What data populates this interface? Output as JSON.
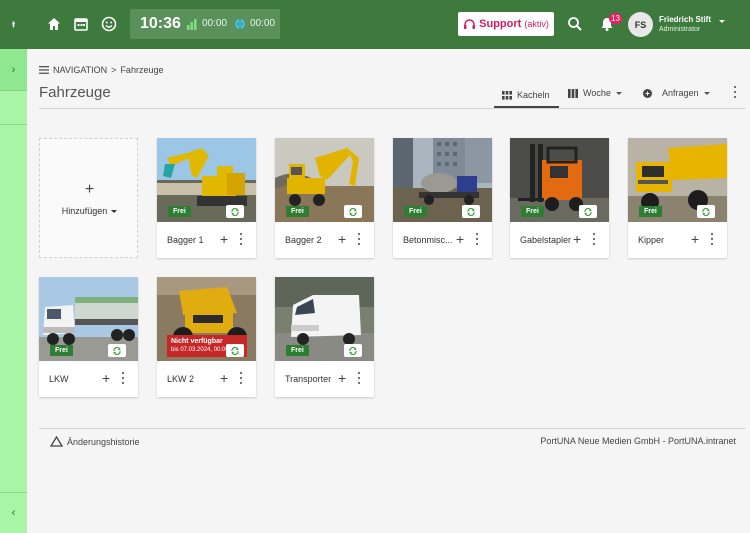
{
  "header": {
    "clock": "10:36",
    "timer1": "00:00",
    "timer2": "00:00",
    "support_label": "Support",
    "support_status": "(aktiv)",
    "notification_count": "13",
    "user_initials": "FS",
    "user_name": "Friedrich Stift",
    "user_role": "Administrator"
  },
  "breadcrumb": {
    "nav": "NAVIGATION",
    "separator": ">",
    "current": "Fahrzeuge"
  },
  "page": {
    "title": "Fahrzeuge"
  },
  "view_controls": {
    "tiles_label": "Kacheln",
    "week_label": "Woche",
    "requests_label": "Anfragen"
  },
  "add_tile": {
    "plus": "+",
    "label": "Hinzufügen"
  },
  "vehicles": [
    {
      "name": "Bagger 1",
      "status": "Frei"
    },
    {
      "name": "Bagger 2",
      "status": "Frei"
    },
    {
      "name": "Betonmisc...",
      "status": "Frei"
    },
    {
      "name": "Gabelstapler",
      "status": "Frei"
    },
    {
      "name": "Kipper",
      "status": "Frei"
    },
    {
      "name": "LKW",
      "status": "Frei"
    },
    {
      "name": "LKW 2",
      "status": "Nicht verfügbar",
      "status_detail": "bis 07.03.2024, 00:00"
    },
    {
      "name": "Transporter",
      "status": "Frei"
    }
  ],
  "tile_actions": {
    "plus": "+"
  },
  "footer": {
    "history": "Änderungshistorie",
    "copyright": "PortUNA Neue Medien GmbH - PortUNA.intranet"
  },
  "colors": {
    "topbar": "#3e7a3e",
    "rail": "#a8f5a8",
    "status_free": "#2e7d32",
    "status_unavailable": "#c62828",
    "support_accent": "#d81b60"
  },
  "icons": [
    "pin-icon",
    "chevron-right-icon",
    "chevron-left-icon",
    "home-icon",
    "calendar-icon",
    "smiley-icon",
    "chart-icon",
    "globe-icon",
    "support-icon",
    "search-icon",
    "bell-icon",
    "menu-icon",
    "grid-icon",
    "columns-icon",
    "request-icon",
    "more-vert-icon",
    "sync-icon",
    "warning-triangle-icon"
  ]
}
